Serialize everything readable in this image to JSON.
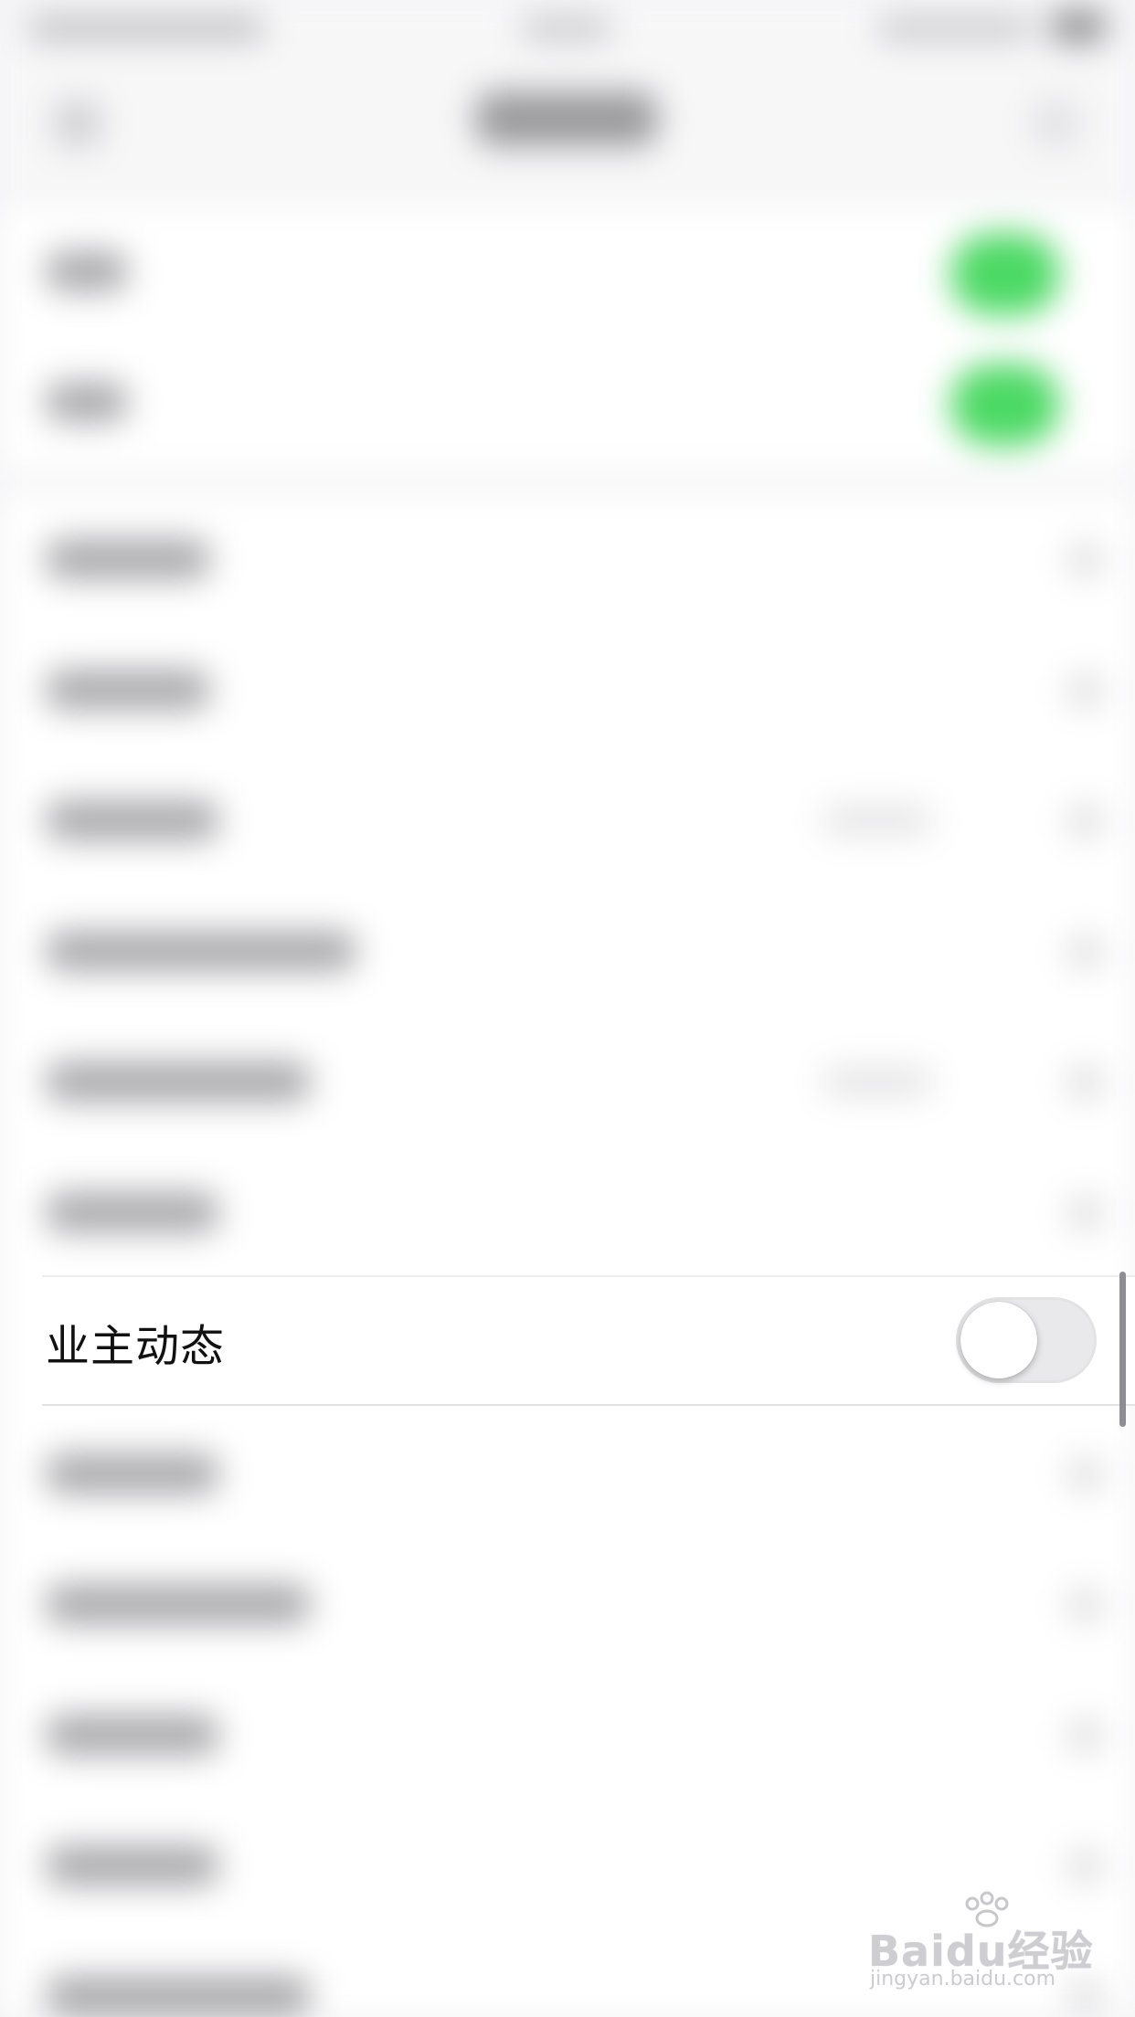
{
  "row": {
    "label": "业主动态",
    "toggle_on": false
  },
  "watermark": {
    "brand": "Baidu经验",
    "url": "jingyan.baidu.com"
  },
  "colors": {
    "toggle_on_green": "#4cd964",
    "toggle_off_track": "#e9e9eb",
    "background": "#f4f4f6"
  }
}
